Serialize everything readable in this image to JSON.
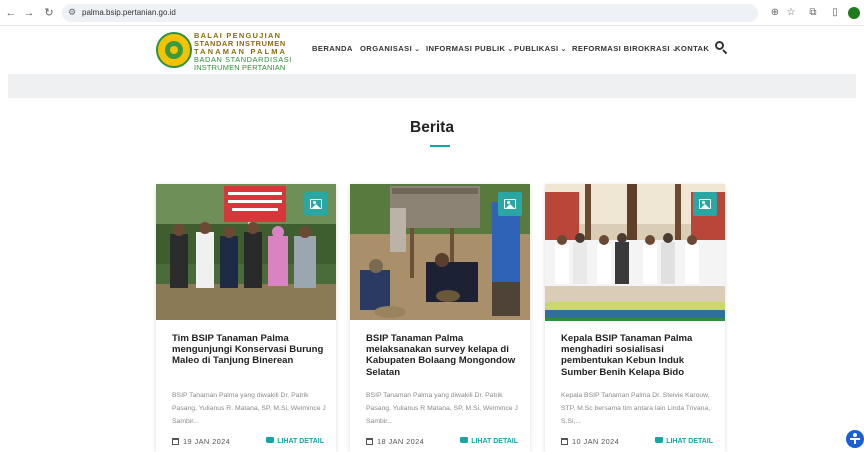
{
  "browser": {
    "url": "palma.bsip.pertanian.go.id"
  },
  "logo": {
    "line1": "BALAI PENGUJIAN",
    "line2": "STANDAR INSTRUMEN",
    "line3": "TANAMAN PALMA",
    "line4": "BADAN STANDARDISASI",
    "line5": "INSTRUMEN PERTANIAN"
  },
  "nav": {
    "items": [
      {
        "label": "BERANDA"
      },
      {
        "label": "ORGANISASI"
      },
      {
        "label": "INFORMASI PUBLIK"
      },
      {
        "label": "PUBLIKASI"
      },
      {
        "label": "REFORMASI BIROKRASI"
      },
      {
        "label": "KONTAK"
      }
    ]
  },
  "section": {
    "title": "Berita"
  },
  "cards": [
    {
      "title": "Tim BSIP Tanaman Palma mengunjungi Konservasi Burung Maleo di Tanjung Binerean",
      "excerpt": "BSIP Tanaman Palma yang diwakili Dr. Patrik Pasang, Yulianus R. Matana, SP, M.Si, Welmince J Sambir...",
      "date": "19 JAN 2024",
      "link": "LIHAT DETAIL"
    },
    {
      "title": "BSIP Tanaman Palma melaksanakan survey kelapa di Kabupaten Bolaang Mongondow Selatan",
      "excerpt": "BSIP Tanaman Palma yang diwakili Dr. Patrik Pasang, Yulianus R Matana, SP, M.Si, Welmince J Sambir...",
      "date": "18 JAN 2024",
      "link": "LIHAT DETAIL"
    },
    {
      "title": "Kepala BSIP Tanaman Palma menghadiri sosialisasi pembentukan Kebun Induk Sumber Benih Kelapa Bido",
      "excerpt": "Kepala BSIP Tanaman Palma Dr. Steivie Karouw, STP, M.Sc bersama tim antara lain Linda Trivana, S.Si,...",
      "date": "10 JAN 2024",
      "link": "LIHAT DETAIL"
    }
  ],
  "colors": {
    "accent": "#18a3a8",
    "brand_green": "#2f8f3a",
    "brand_gold": "#8a6d0d"
  }
}
